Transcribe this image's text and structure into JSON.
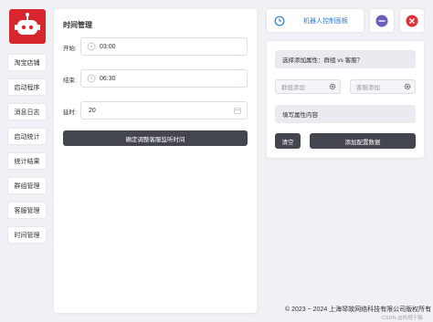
{
  "sidebar": {
    "items": [
      {
        "label": "淘宝店铺"
      },
      {
        "label": "启动程序"
      },
      {
        "label": "消息日志"
      },
      {
        "label": "启动统计"
      },
      {
        "label": "统计结果"
      },
      {
        "label": "群组管理"
      },
      {
        "label": "客服管理"
      },
      {
        "label": "时间管理"
      }
    ]
  },
  "time_panel": {
    "title": "时间管理",
    "start_label": "开始:",
    "start_value": "03:00",
    "end_label": "结束:",
    "end_value": "06:30",
    "interval_label": "延时:",
    "interval_value": "20",
    "confirm_button": "确定调整客服监听时间"
  },
  "top_bar": {
    "console_button": "机器人控制面板"
  },
  "right_panel": {
    "select_placeholder": "选择添加属性：群组 vs 客服？",
    "group_add": "群组添加",
    "agent_add": "客服添加",
    "attr_placeholder": "填写属性内容",
    "clear_button": "清空",
    "add_config_button": "添加配置数据"
  },
  "footer": {
    "copyright": "© 2023 ~ 2024 上海琴故网络科技有限公司版权所有",
    "watermark": "CSDN @执规于猿"
  },
  "colors": {
    "brand_red": "#d8262f",
    "dark_button": "#44464f",
    "accent_blue": "#2b7fd6",
    "purple": "#6f5bb8",
    "red": "#e0303a"
  },
  "icons": {
    "logo": "robot-logo-icon",
    "time": "clock-icon",
    "settings": "gear-icon",
    "calendar": "calendar-icon"
  }
}
